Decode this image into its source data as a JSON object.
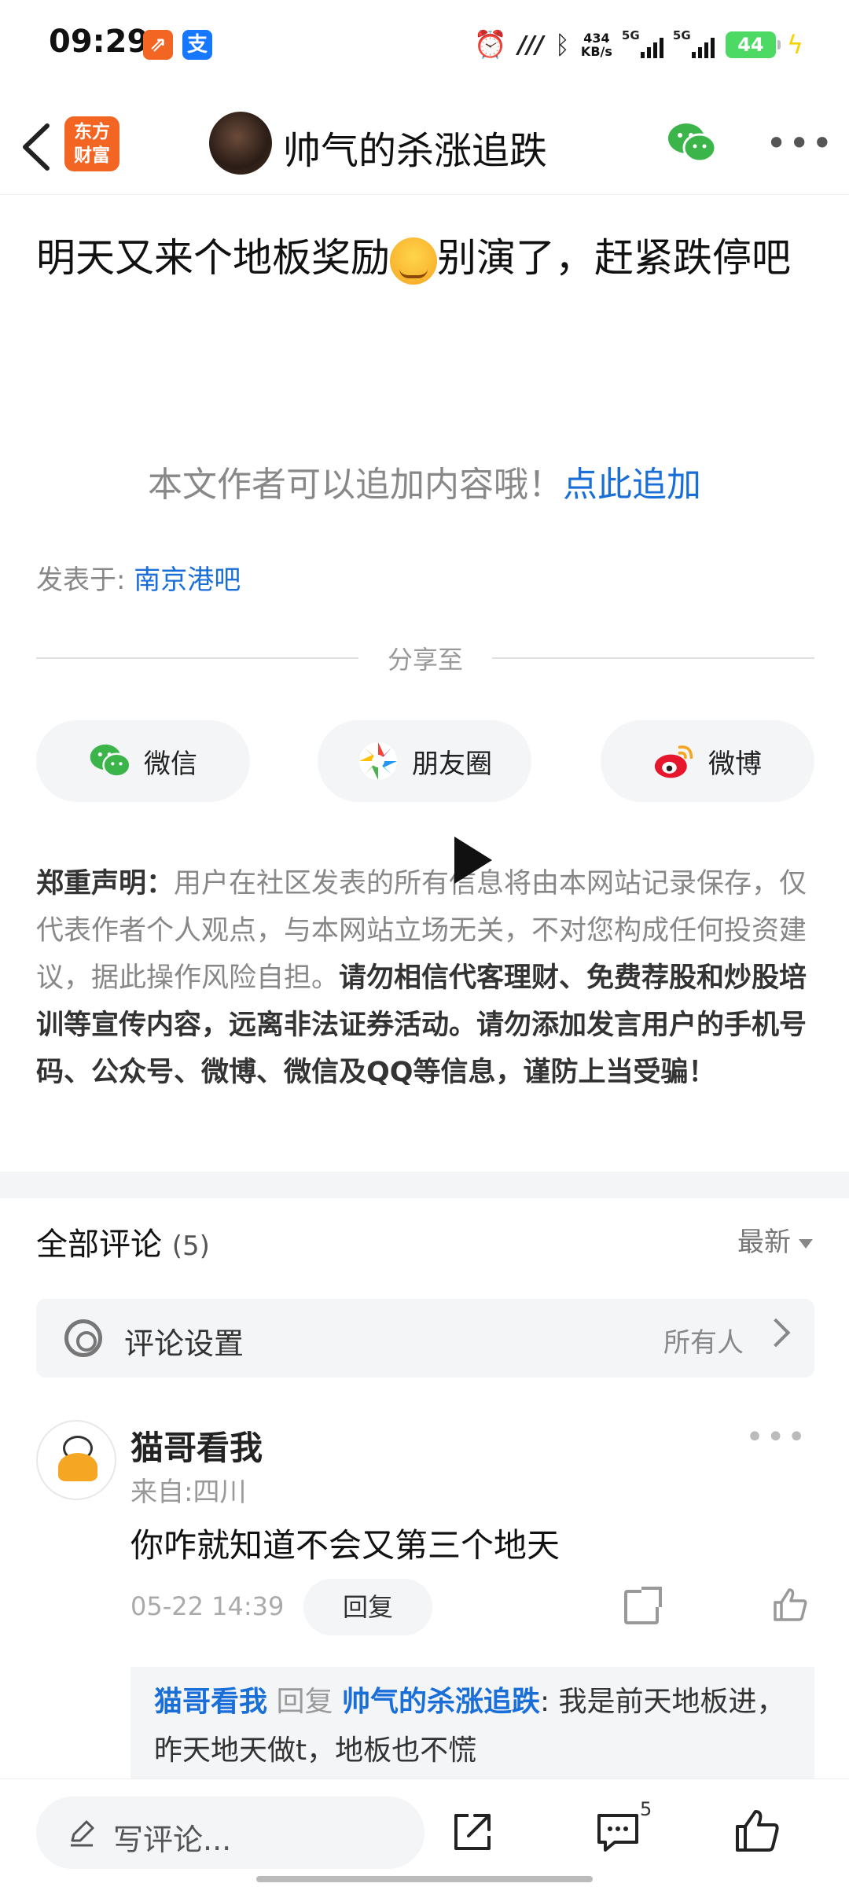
{
  "status_bar": {
    "time": "09:29",
    "net_speed_value": "434",
    "net_speed_unit": "KB/s",
    "signal1_label": "5G",
    "signal2_label": "5G",
    "battery": "44",
    "icons": [
      "alarm-icon",
      "nfc-icon",
      "bluetooth-icon",
      "charging-icon"
    ]
  },
  "header": {
    "brand_line1": "东方",
    "brand_line2": "财富",
    "brand_color": "#f26522",
    "author": "帅气的杀涨追跌",
    "back_icon": "chevron-left-icon",
    "wechat_icon": "wechat-icon",
    "more_icon": "more-dots-icon"
  },
  "post": {
    "title_part1": "明天又来个地板奖励",
    "title_part2": "别演了，赶紧跌停吧",
    "append_text": "本文作者可以追加内容哦！",
    "append_link": "点此追加",
    "posted_label": "发表于: ",
    "posted_board": "南京港吧"
  },
  "share": {
    "divider_label": "分享至",
    "buttons": [
      {
        "label": "微信",
        "icon": "wechat-icon"
      },
      {
        "label": "朋友圈",
        "icon": "moments-icon"
      },
      {
        "label": "微博",
        "icon": "weibo-icon"
      }
    ]
  },
  "disclaimer": {
    "heading": "郑重声明：",
    "normal": "用户在社区发表的所有信息将由本网站记录保存，仅代表作者个人观点，与本网站立场无关，不对您构成任何投资建议，据此操作风险自担。",
    "bold": "请勿相信代客理财、免费荐股和炒股培训等宣传内容，远离非法证券活动。请勿添加发言用户的手机号码、公众号、微博、微信及QQ等信息，谨防上当受骗！"
  },
  "comments": {
    "title": "全部评论",
    "count": "(5)",
    "sort": "最新",
    "settings_label": "评论设置",
    "settings_value": "所有人",
    "items": [
      {
        "user": "猫哥看我",
        "from": "来自:四川",
        "text": "你咋就知道不会又第三个地天",
        "time": "05-22 14:39",
        "reply_label": "回复",
        "reply": {
          "from_user": "猫哥看我",
          "verb": "回复",
          "to_user": "帅气的杀涨追跌",
          "text": ": 我是前天地板进，昨天地天做t，地板也不慌"
        }
      }
    ]
  },
  "bottom_bar": {
    "write_placeholder": "写评论...",
    "comment_count": "5"
  }
}
